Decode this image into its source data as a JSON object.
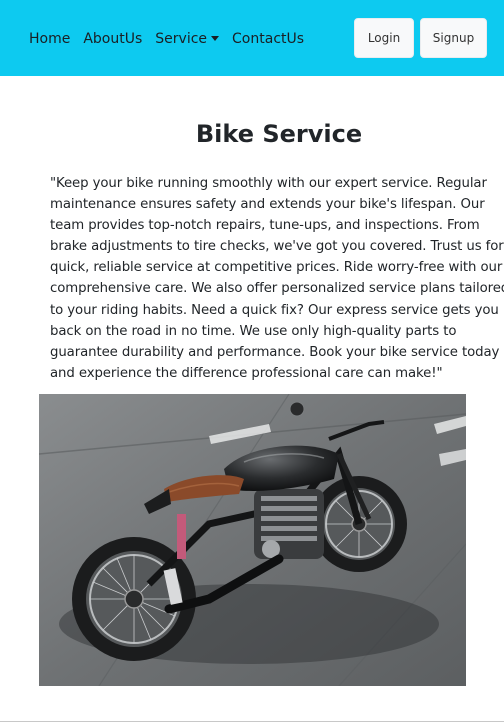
{
  "navbar": {
    "links": [
      "Home",
      "AboutUs",
      "Service",
      "ContactUs"
    ],
    "login_label": "Login",
    "signup_label": "Signup",
    "background": "#0dcaf0"
  },
  "main": {
    "title": "Bike Service",
    "description": "\"Keep your bike running smoothly with our expert service. Regular maintenance ensures safety and extends your bike's lifespan. Our team provides top-notch repairs, tune-ups, and inspections. From brake adjustments to tire checks, we've got you covered. Trust us for quick, reliable service at competitive prices. Ride worry-free with our comprehensive care. We also offer personalized service plans tailored to your riding habits. Need a quick fix? Our express service gets you back on the road in no time. We use only high-quality parts to guarantee durability and performance. Book your bike service today and experience the difference professional care can make!\""
  }
}
